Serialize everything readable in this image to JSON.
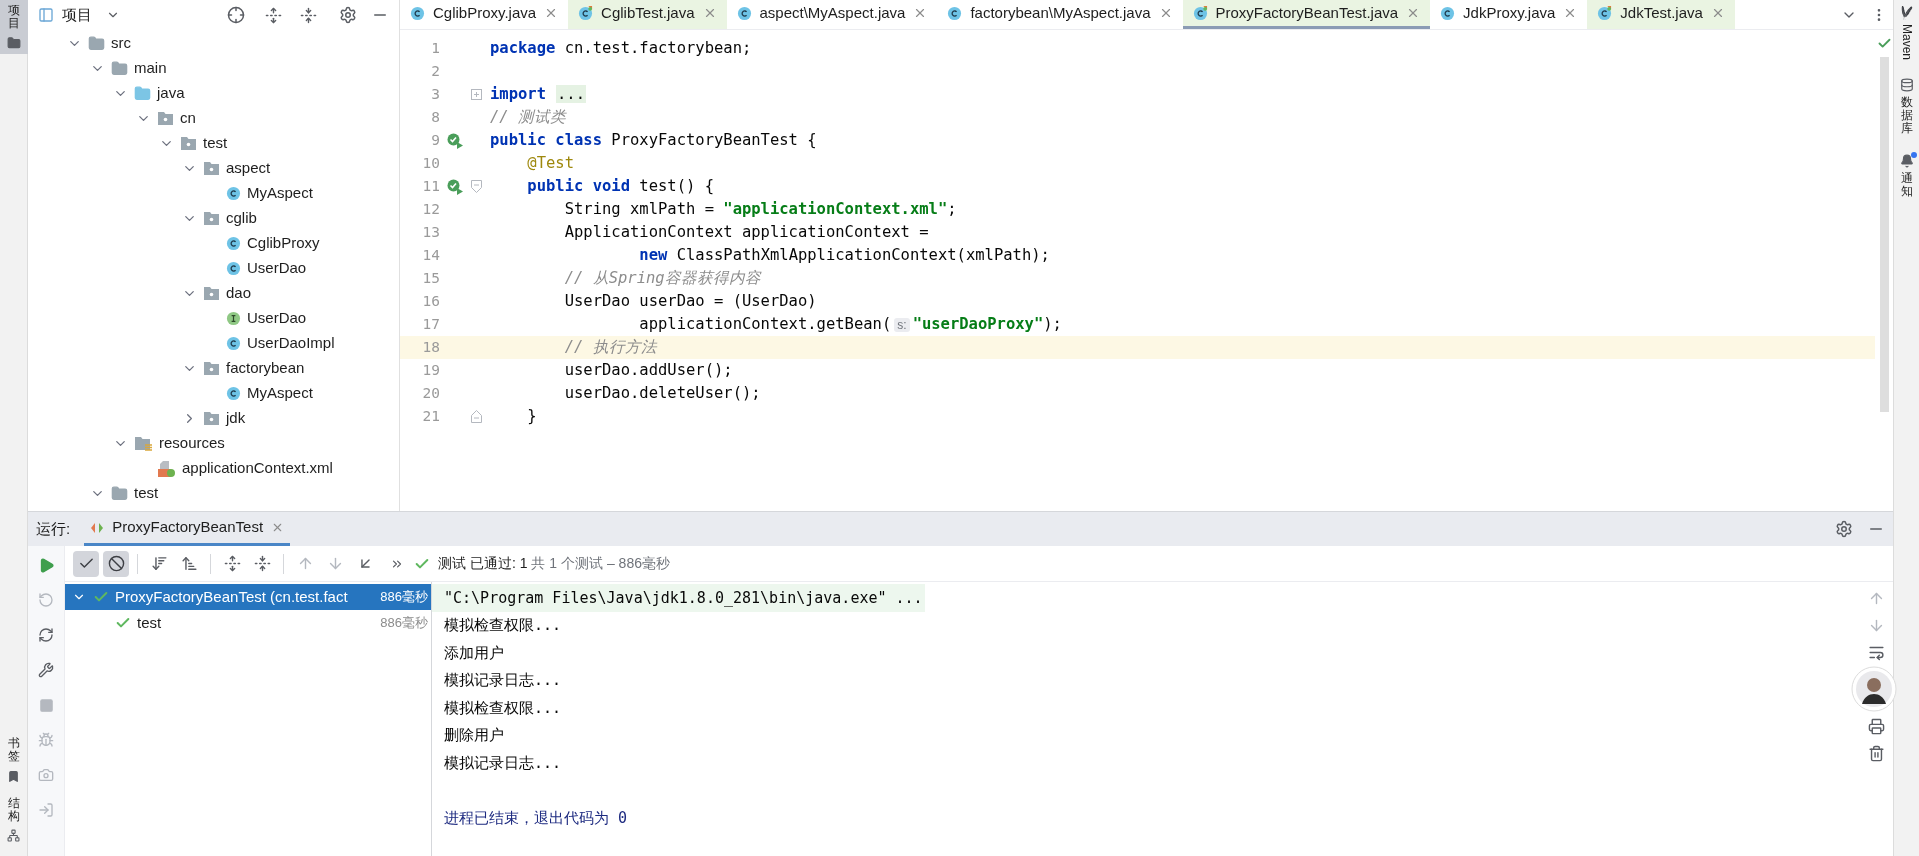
{
  "left_strip": {
    "top": [
      {
        "label": "项目",
        "selected": true
      }
    ],
    "bottom": [
      {
        "label": "书签",
        "kind": "bookmark"
      },
      {
        "label": "结构",
        "kind": "structure"
      }
    ]
  },
  "project_panel": {
    "title": "项目",
    "tree": [
      {
        "label": "src",
        "kind": "folder",
        "expanded": true,
        "children": [
          {
            "label": "main",
            "kind": "folder",
            "expanded": true,
            "children": [
              {
                "label": "java",
                "kind": "source",
                "expanded": true,
                "children": [
                  {
                    "label": "cn",
                    "kind": "package",
                    "expanded": true,
                    "children": [
                      {
                        "label": "test",
                        "kind": "package",
                        "expanded": true,
                        "children": [
                          {
                            "label": "aspect",
                            "kind": "package",
                            "expanded": true,
                            "children": [
                              {
                                "label": "MyAspect",
                                "kind": "class"
                              }
                            ]
                          },
                          {
                            "label": "cglib",
                            "kind": "package",
                            "expanded": true,
                            "children": [
                              {
                                "label": "CglibProxy",
                                "kind": "class"
                              },
                              {
                                "label": "UserDao",
                                "kind": "class"
                              }
                            ]
                          },
                          {
                            "label": "dao",
                            "kind": "package",
                            "expanded": true,
                            "children": [
                              {
                                "label": "UserDao",
                                "kind": "interface"
                              },
                              {
                                "label": "UserDaoImpl",
                                "kind": "class"
                              }
                            ]
                          },
                          {
                            "label": "factorybean",
                            "kind": "package",
                            "expanded": true,
                            "children": [
                              {
                                "label": "MyAspect",
                                "kind": "class"
                              }
                            ]
                          },
                          {
                            "label": "jdk",
                            "kind": "package",
                            "expanded": false
                          }
                        ]
                      }
                    ]
                  }
                ]
              },
              {
                "label": "resources",
                "kind": "resources",
                "expanded": true,
                "children": [
                  {
                    "label": "applicationContext.xml",
                    "kind": "xml"
                  }
                ]
              }
            ]
          },
          {
            "label": "test",
            "kind": "folder",
            "expanded": true
          }
        ]
      }
    ]
  },
  "editor": {
    "tabs": [
      {
        "label": "CglibProxy.java",
        "kind": "class",
        "selected": false
      },
      {
        "label": "CglibTest.java",
        "kind": "test",
        "selected": false
      },
      {
        "label": "aspect\\MyAspect.java",
        "kind": "class",
        "selected": false
      },
      {
        "label": "factorybean\\MyAspect.java",
        "kind": "class",
        "selected": false
      },
      {
        "label": "ProxyFactoryBeanTest.java",
        "kind": "test",
        "selected": true
      },
      {
        "label": "JdkProxy.java",
        "kind": "class",
        "selected": false
      },
      {
        "label": "JdkTest.java",
        "kind": "test",
        "selected": false
      }
    ],
    "lines": [
      {
        "number": "1",
        "tokens": [
          {
            "kind": "keyword",
            "text": "package"
          },
          {
            "kind": "plain",
            "text": " cn.test.factorybean;"
          }
        ]
      },
      {
        "number": "2"
      },
      {
        "number": "3",
        "collapsed": true,
        "tokens": [
          {
            "kind": "keyword",
            "text": "import"
          },
          {
            "kind": "folded",
            "text": "..."
          }
        ]
      },
      {
        "number": "8",
        "tokens": [
          {
            "kind": "comment",
            "text": "// 测试类"
          }
        ]
      },
      {
        "number": "9",
        "run": true,
        "tokens": [
          {
            "kind": "keyword",
            "text": "public class"
          },
          {
            "kind": "plain",
            "text": " ProxyFactoryBeanTest {"
          }
        ]
      },
      {
        "number": "10",
        "tokens": [
          {
            "kind": "annotation",
            "text": "    @Test"
          }
        ]
      },
      {
        "number": "11",
        "run": true,
        "fold_start": true,
        "tokens": [
          {
            "kind": "keyword",
            "text": "    public void"
          },
          {
            "kind": "plain",
            "text": " test() {"
          }
        ]
      },
      {
        "number": "12",
        "tokens": [
          {
            "kind": "plain",
            "text": "        String xmlPath = "
          },
          {
            "kind": "string",
            "text": "\"applicationContext.xml\""
          },
          {
            "kind": "plain",
            "text": ";"
          }
        ]
      },
      {
        "number": "13",
        "tokens": [
          {
            "kind": "plain",
            "text": "        ApplicationContext applicationContext ="
          }
        ]
      },
      {
        "number": "14",
        "tokens": [
          {
            "kind": "keyword",
            "text": "                new"
          },
          {
            "kind": "plain",
            "text": " ClassPathXmlApplicationContext(xmlPath);"
          }
        ]
      },
      {
        "number": "15",
        "tokens": [
          {
            "kind": "comment",
            "text": "        // 从Spring容器获得内容"
          }
        ]
      },
      {
        "number": "16",
        "tokens": [
          {
            "kind": "plain",
            "text": "        UserDao userDao = (UserDao)"
          }
        ]
      },
      {
        "number": "17",
        "tokens": [
          {
            "kind": "plain",
            "text": "                applicationContext.getBean("
          },
          {
            "kind": "hint",
            "text": "s:"
          },
          {
            "kind": "string",
            "text": "\"userDaoProxy\""
          },
          {
            "kind": "plain",
            "text": ");"
          }
        ]
      },
      {
        "number": "18",
        "current": true,
        "tokens": [
          {
            "kind": "comment",
            "text": "        // 执行方法"
          }
        ]
      },
      {
        "number": "19",
        "tokens": [
          {
            "kind": "plain",
            "text": "        userDao.addUser();"
          }
        ]
      },
      {
        "number": "20",
        "tokens": [
          {
            "kind": "plain",
            "text": "        userDao.deleteUser();"
          }
        ]
      },
      {
        "number": "21",
        "fold_end": true,
        "tokens": [
          {
            "kind": "plain",
            "text": "    }"
          }
        ]
      }
    ]
  },
  "run_panel": {
    "label": "运行:",
    "tab": "ProxyFactoryBeanTest",
    "toggles": [
      {
        "kind": "check",
        "on": true
      },
      {
        "kind": "ban",
        "on": true
      }
    ],
    "status": "测试 已通过: 1",
    "status_detail": "共 1 个测试 – 886毫秒",
    "results": [
      {
        "label": "ProxyFactoryBeanTest (cn.test.fact",
        "time": "886毫秒",
        "passed": true,
        "selected": true,
        "expanded": true,
        "children": [
          {
            "label": "test",
            "time": "886毫秒",
            "passed": true,
            "selected": false
          }
        ]
      }
    ],
    "console": [
      {
        "kind": "command",
        "text": "\"C:\\Program Files\\Java\\jdk1.8.0_281\\bin\\java.exe\" ..."
      },
      {
        "kind": "output",
        "text": "模拟检查权限..."
      },
      {
        "kind": "output",
        "text": "添加用户"
      },
      {
        "kind": "output",
        "text": "模拟记录日志..."
      },
      {
        "kind": "output",
        "text": "模拟检查权限..."
      },
      {
        "kind": "output",
        "text": "删除用户"
      },
      {
        "kind": "output",
        "text": "模拟记录日志..."
      },
      {
        "kind": "blank"
      },
      {
        "kind": "exit",
        "text": "进程已结束，退出代码为 0"
      }
    ]
  },
  "right_strip": [
    {
      "label": "Maven",
      "kind": "maven"
    },
    {
      "label": "数据库",
      "kind": "database"
    },
    {
      "label": "通知",
      "kind": "bell",
      "badge": true
    }
  ]
}
